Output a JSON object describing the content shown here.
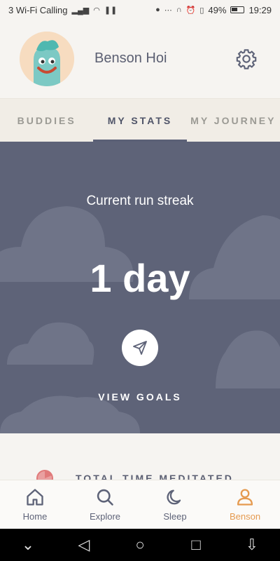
{
  "status_bar": {
    "carrier": "3 Wi-Fi Calling",
    "battery": "49%",
    "time": "19:29"
  },
  "profile": {
    "name": "Benson Hoi"
  },
  "tabs": [
    {
      "label": "BUDDIES",
      "active": false
    },
    {
      "label": "MY STATS",
      "active": true
    },
    {
      "label": "MY JOURNEY",
      "active": false
    }
  ],
  "stats": {
    "streak_label": "Current run streak",
    "streak_value": "1 day",
    "view_goals_label": "VIEW GOALS"
  },
  "content": {
    "total_time_label": "TOTAL TIME MEDITATED"
  },
  "bottom_nav": [
    {
      "label": "Home",
      "icon": "home-icon",
      "active": false
    },
    {
      "label": "Explore",
      "icon": "search-icon",
      "active": false
    },
    {
      "label": "Sleep",
      "icon": "moon-icon",
      "active": false
    },
    {
      "label": "Benson",
      "icon": "person-icon",
      "active": true
    }
  ],
  "colors": {
    "accent": "#e59a4f",
    "panel": "#5e6378",
    "background": "#f6f4f1"
  }
}
